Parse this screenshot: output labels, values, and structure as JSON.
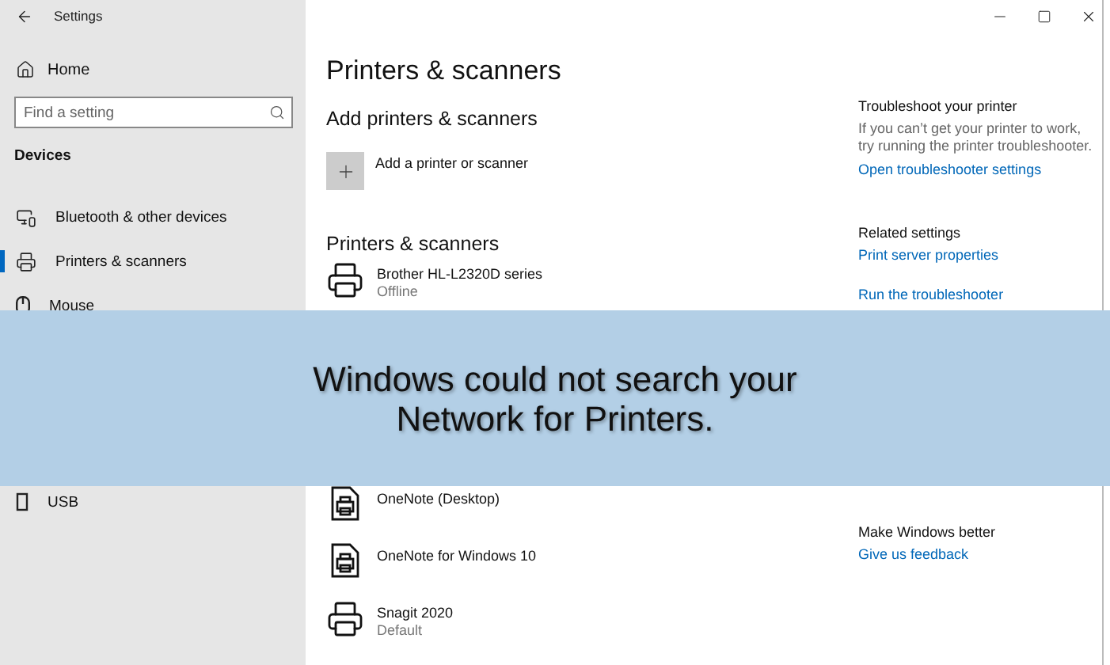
{
  "window": {
    "title": "Settings"
  },
  "sidebar": {
    "home": "Home",
    "search": {
      "placeholder": "Find a setting"
    },
    "section": "Devices",
    "items": [
      {
        "label": "Bluetooth & other devices",
        "kind": "devices",
        "selected": false
      },
      {
        "label": "Printers & scanners",
        "kind": "printer",
        "selected": true
      },
      {
        "label": "Mouse",
        "kind": "mouse",
        "selected": false
      },
      {
        "label": "USB",
        "kind": "usb",
        "selected": false
      }
    ]
  },
  "main": {
    "title": "Printers & scanners",
    "add_heading": "Add printers & scanners",
    "add_button": "Add a printer or scanner",
    "list_heading": "Printers & scanners",
    "printers": [
      {
        "name": "Brother HL-L2320D series",
        "status": "Offline",
        "kind": "printer"
      },
      {
        "name": "OneNote (Desktop)",
        "kind": "document"
      },
      {
        "name": "OneNote for Windows 10",
        "kind": "document"
      },
      {
        "name": "Snagit 2020",
        "status": "Default",
        "kind": "printer"
      }
    ]
  },
  "side_panel": {
    "sections": [
      {
        "heading": "Troubleshoot your printer",
        "text": "If you can’t get your printer to work, try running the printer troubleshooter.",
        "links": [
          "Open troubleshooter settings"
        ]
      },
      {
        "heading": "Related settings",
        "links": [
          "Print server properties",
          "Run the troubleshooter"
        ]
      },
      {
        "heading": "Make Windows better",
        "links": [
          "Give us feedback"
        ]
      }
    ]
  },
  "banner": {
    "text": "Windows could not search your Network for Printers."
  }
}
